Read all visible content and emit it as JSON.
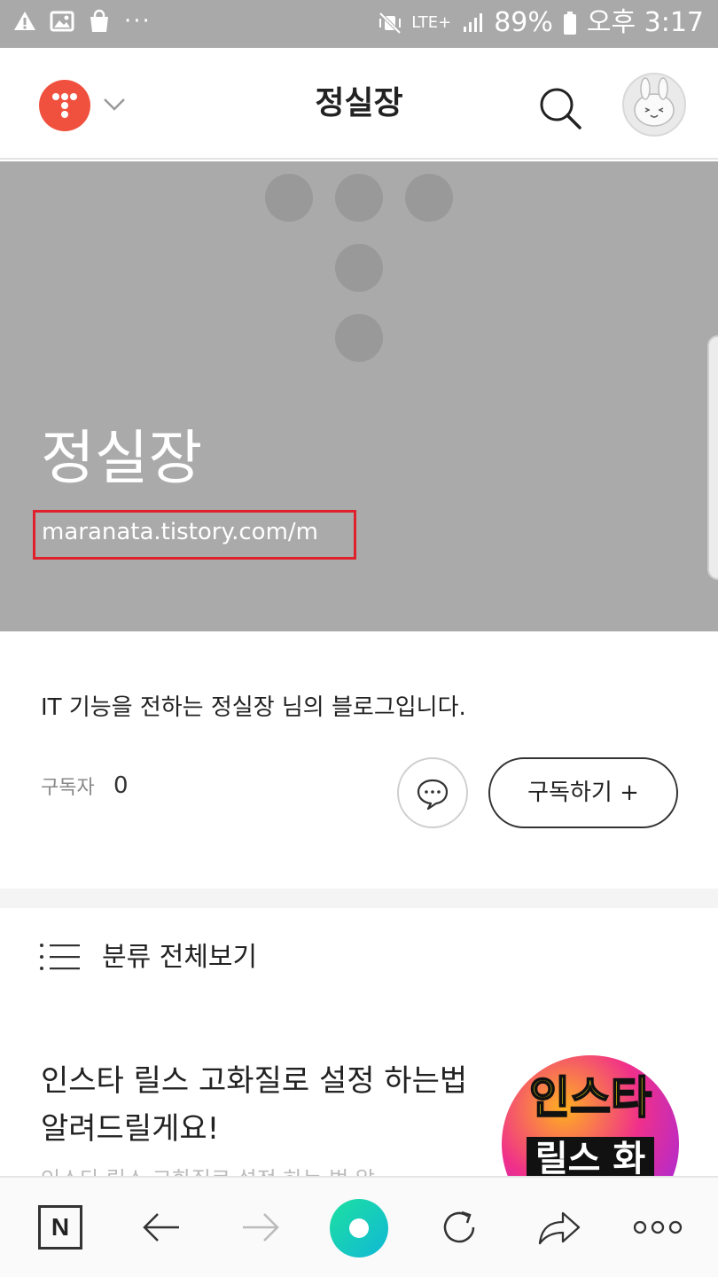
{
  "status_bar": {
    "battery": "89%",
    "time": "오후 3:17",
    "network": "LTE+",
    "left_icons": [
      "warning-icon",
      "image-icon",
      "shopping-bag-icon",
      "more-dots-icon"
    ],
    "right_icons": [
      "mute-vibrate-icon",
      "lte-icon",
      "signal-icon",
      "battery-icon"
    ]
  },
  "header": {
    "title": "정실장"
  },
  "hero": {
    "blog_name": "정실장",
    "url": "maranata.tistory.com/m"
  },
  "intro": {
    "description": "IT 기능을 전하는 정실장 님의 블로그입니다.",
    "subscriber_label": "구독자",
    "subscriber_count": "0",
    "subscribe_button": "구독하기 +"
  },
  "category": {
    "label": "분류 전체보기"
  },
  "post": {
    "title": "인스타 릴스 고화질로 설정 하는법 알려드릴게요!",
    "excerpt": "인스타 릴스 고화질로 설정 하는 법 알",
    "thumb_line1": "인스타",
    "thumb_line2": "릴스 화질"
  },
  "colors": {
    "accent": "#f0513f",
    "hero_bg": "#aaaaaa",
    "highlight_box": "#e0202a",
    "home_orb": "#10c9b0"
  }
}
